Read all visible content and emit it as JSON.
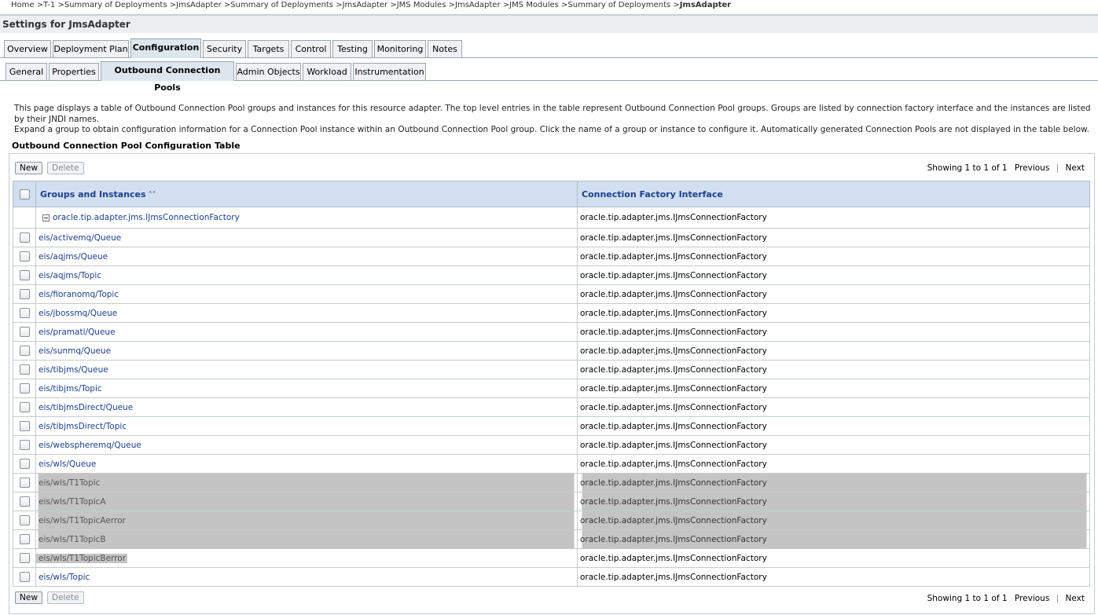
{
  "breadcrumb": {
    "items": [
      "Home",
      "T-1",
      "Summary of Deployments",
      "JmsAdapter",
      "Summary of Deployments",
      "JmsAdapter",
      "JMS Modules",
      "JmsAdapter",
      "JMS Modules",
      "Summary of Deployments"
    ],
    "current": "JmsAdapter",
    "separator": ">"
  },
  "page": {
    "title": "Settings for JmsAdapter"
  },
  "tabs_primary": [
    "Overview",
    "Deployment Plan",
    "Configuration",
    "Security",
    "Targets",
    "Control",
    "Testing",
    "Monitoring",
    "Notes"
  ],
  "tabs_primary_active": "Configuration",
  "tabs_secondary": [
    "General",
    "Properties",
    "Outbound Connection Pools",
    "Admin Objects",
    "Workload",
    "Instrumentation"
  ],
  "tabs_secondary_active": "Outbound Connection Pools",
  "description": {
    "line1": "This page displays a table of Outbound Connection Pool groups and instances for this resource adapter. The top level entries in the table represent Outbound Connection Pool groups. Groups are listed by connection factory interface and the instances are listed by their JNDI names.",
    "line2": "Expand a group to obtain configuration information for a Connection Pool instance within an Outbound Connection Pool group. Click the name of a group or instance to configure it. Automatically generated Connection Pools are not displayed in the table below."
  },
  "table": {
    "title": "Outbound Connection Pool Configuration Table",
    "new_label": "New",
    "delete_label": "Delete",
    "pager": {
      "showing": "Showing 1 to 1 of 1",
      "previous": "Previous",
      "next": "Next"
    },
    "columns": [
      "Groups and Instances",
      "Connection Factory Interface"
    ],
    "group": {
      "name": "oracle.tip.adapter.jms.IJmsConnectionFactory",
      "interface": "oracle.tip.adapter.jms.IJmsConnectionFactory"
    },
    "rows": [
      {
        "name": "eis/activemq/Queue",
        "interface": "oracle.tip.adapter.jms.IJmsConnectionFactory",
        "selected": false
      },
      {
        "name": "eis/aqjms/Queue",
        "interface": "oracle.tip.adapter.jms.IJmsConnectionFactory",
        "selected": false
      },
      {
        "name": "eis/aqjms/Topic",
        "interface": "oracle.tip.adapter.jms.IJmsConnectionFactory",
        "selected": false
      },
      {
        "name": "eis/fioranomq/Topic",
        "interface": "oracle.tip.adapter.jms.IJmsConnectionFactory",
        "selected": false
      },
      {
        "name": "eis/jbossmq/Queue",
        "interface": "oracle.tip.adapter.jms.IJmsConnectionFactory",
        "selected": false
      },
      {
        "name": "eis/pramati/Queue",
        "interface": "oracle.tip.adapter.jms.IJmsConnectionFactory",
        "selected": false
      },
      {
        "name": "eis/sunmq/Queue",
        "interface": "oracle.tip.adapter.jms.IJmsConnectionFactory",
        "selected": false
      },
      {
        "name": "eis/tibjms/Queue",
        "interface": "oracle.tip.adapter.jms.IJmsConnectionFactory",
        "selected": false
      },
      {
        "name": "eis/tibjms/Topic",
        "interface": "oracle.tip.adapter.jms.IJmsConnectionFactory",
        "selected": false
      },
      {
        "name": "eis/tibjmsDirect/Queue",
        "interface": "oracle.tip.adapter.jms.IJmsConnectionFactory",
        "selected": false
      },
      {
        "name": "eis/tibjmsDirect/Topic",
        "interface": "oracle.tip.adapter.jms.IJmsConnectionFactory",
        "selected": false
      },
      {
        "name": "eis/webspheremq/Queue",
        "interface": "oracle.tip.adapter.jms.IJmsConnectionFactory",
        "selected": false
      },
      {
        "name": "eis/wls/Queue",
        "interface": "oracle.tip.adapter.jms.IJmsConnectionFactory",
        "selected": false
      },
      {
        "name": "eis/wls/T1Topic",
        "interface": "oracle.tip.adapter.jms.IJmsConnectionFactory",
        "selected": true
      },
      {
        "name": "eis/wls/T1TopicA",
        "interface": "oracle.tip.adapter.jms.IJmsConnectionFactory",
        "selected": true
      },
      {
        "name": "eis/wls/T1TopicAerror",
        "interface": "oracle.tip.adapter.jms.IJmsConnectionFactory",
        "selected": true
      },
      {
        "name": "eis/wls/T1TopicB",
        "interface": "oracle.tip.adapter.jms.IJmsConnectionFactory",
        "selected": true
      },
      {
        "name": "eis/wls/T1TopicBerror",
        "interface": "oracle.tip.adapter.jms.IJmsConnectionFactory",
        "selected": "partial"
      },
      {
        "name": "eis/wls/Topic",
        "interface": "oracle.tip.adapter.jms.IJmsConnectionFactory",
        "selected": false
      }
    ]
  },
  "colors": {
    "link": "#1b3f8f",
    "header_bg": "#d2dff0",
    "selection": "#c4c4c4",
    "active_tab_bg": "#dde6ee"
  }
}
